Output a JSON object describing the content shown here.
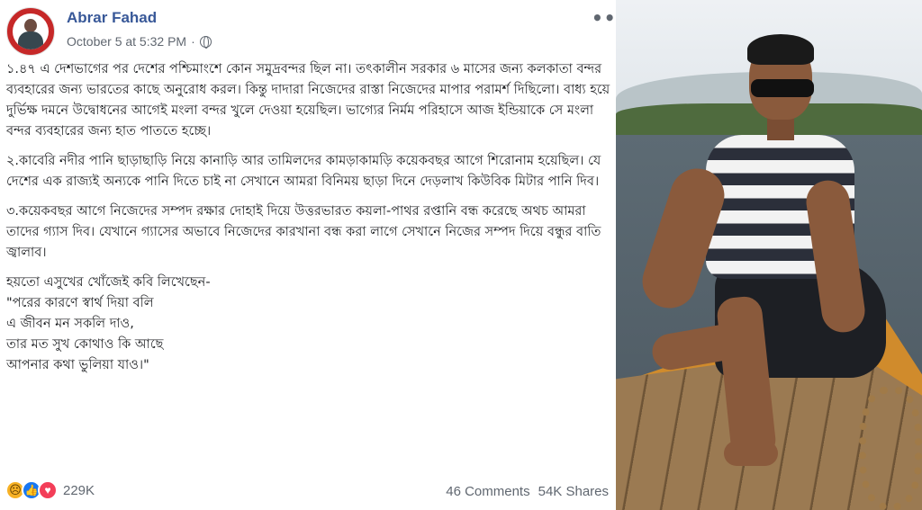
{
  "post": {
    "author": "Abrar Fahad",
    "timestamp": "October 5 at 5:32 PM",
    "timestamp_separator": "·",
    "more_label": "•••",
    "paragraphs": [
      "১.৪৭ এ দেশভাগের পর দেশের পশ্চিমাংশে কোন সমুদ্রবন্দর ছিল না। তৎকালীন সরকার ৬ মাসের জন্য কলকাতা বন্দর ব্যবহারের জন্য ভারতের কাছে অনুরোধ করল। কিন্তু দাদারা নিজেদের রাস্তা নিজেদের মাপার পরামর্শ দিছিলো। বাধ্য হয়ে দুর্ভিক্ষ দমনে উদ্বোধনের আগেই মংলা বন্দর খুলে দেওয়া হয়েছিল। ভাগ্যের নির্মম পরিহাসে আজ ইন্ডিয়াকে সে মংলা বন্দর ব্যবহারের জন্য হাত পাততে হচ্ছে।",
      "২.কাবেরি নদীর পানি ছাড়াছাড়ি নিয়ে কানাড়ি আর তামিলদের কামড়াকামড়ি কয়েকবছর আগে শিরোনাম হয়েছিল। যে দেশের এক রাজ্যই অন্যকে পানি দিতে চাই না সেখানে আমরা বিনিময় ছাড়া দিনে দেড়লাখ কিউবিক মিটার পানি দিব।",
      "৩.কয়েকবছর আগে নিজেদের সম্পদ রক্ষার দোহাই দিয়ে উত্তরভারত কয়লা-পাথর রপ্তানি বন্ধ করেছে অথচ আমরা তাদের গ্যাস দিব। যেখানে গ্যাসের অভাবে নিজেদের কারখানা বন্ধ করা লাগে সেখানে নিজের সম্পদ দিয়ে বন্ধুর বাতি জ্বালাব।"
    ],
    "quote_intro": "হয়তো এসুখের খোঁজেই কবি লিখেছেন-",
    "quote_lines": [
      "\"পরের কারণে স্বার্থ দিয়া বলি",
      "এ জীবন মন সকলি দাও,",
      "তার মত সুখ কোথাও কি আছে",
      "আপনার কথা ভুলিয়া যাও।\""
    ]
  },
  "reactions": {
    "icons": [
      "sad-icon",
      "like-icon",
      "love-icon"
    ],
    "count": "229K"
  },
  "stats": {
    "comments": "46 Comments",
    "shares": "54K Shares"
  },
  "colors": {
    "author_link": "#385898",
    "meta_text": "#606770",
    "like_blue": "#1877f2",
    "love_red": "#f33e58",
    "sad_yellow": "#f7b125"
  }
}
